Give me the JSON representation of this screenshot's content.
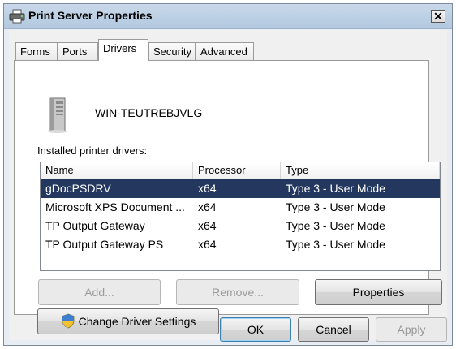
{
  "window": {
    "title": "Print Server Properties",
    "close_glyph": "✕"
  },
  "tabs": [
    {
      "label": "Forms"
    },
    {
      "label": "Ports"
    },
    {
      "label": "Drivers",
      "active": true
    },
    {
      "label": "Security"
    },
    {
      "label": "Advanced"
    }
  ],
  "server": {
    "name": "WIN-TEUTREBJVLG",
    "icon": "server-tower-icon"
  },
  "drivers": {
    "label": "Installed printer drivers:",
    "columns": [
      "Name",
      "Processor",
      "Type"
    ],
    "rows": [
      {
        "name": "gDocPSDRV",
        "processor": "x64",
        "type": "Type 3 - User Mode",
        "selected": true
      },
      {
        "name": "Microsoft XPS Document ...",
        "processor": "x64",
        "type": "Type 3 - User Mode"
      },
      {
        "name": "TP Output Gateway",
        "processor": "x64",
        "type": "Type 3 - User Mode"
      },
      {
        "name": "TP Output Gateway PS",
        "processor": "x64",
        "type": "Type 3 - User Mode"
      }
    ],
    "selection_color": "#23375f"
  },
  "buttons": {
    "add": "Add...",
    "remove": "Remove...",
    "properties": "Properties",
    "change_settings": "Change Driver Settings",
    "ok": "OK",
    "cancel": "Cancel",
    "apply": "Apply"
  },
  "colors": {
    "title_bar": "#b9cde3",
    "frame": "#e8edf3",
    "selection": "#23375f"
  }
}
